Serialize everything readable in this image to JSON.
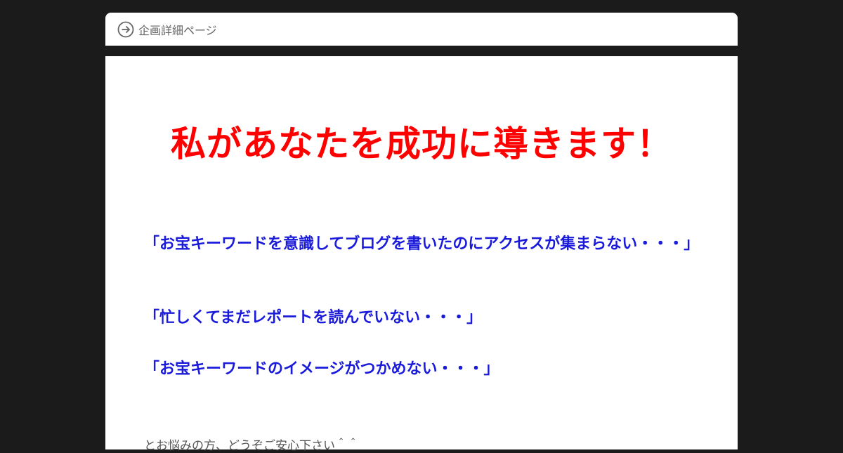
{
  "header": {
    "title": "企画詳細ページ",
    "icon": "arrow-right-circle-icon"
  },
  "main": {
    "headline": "私があなたを成功に導きます！",
    "quotes": [
      "「お宝キーワードを意識してブログを書いたのにアクセスが集まらない・・・」",
      "「忙しくてまだレポートを読んでいない・・・」",
      "「お宝キーワードのイメージがつかめない・・・」"
    ],
    "body_text": "とお悩みの方、どうぞご安心下さい＾＾"
  },
  "colors": {
    "background": "#1b1b1b",
    "headline": "#ff0000",
    "quote": "#1a1adb"
  }
}
